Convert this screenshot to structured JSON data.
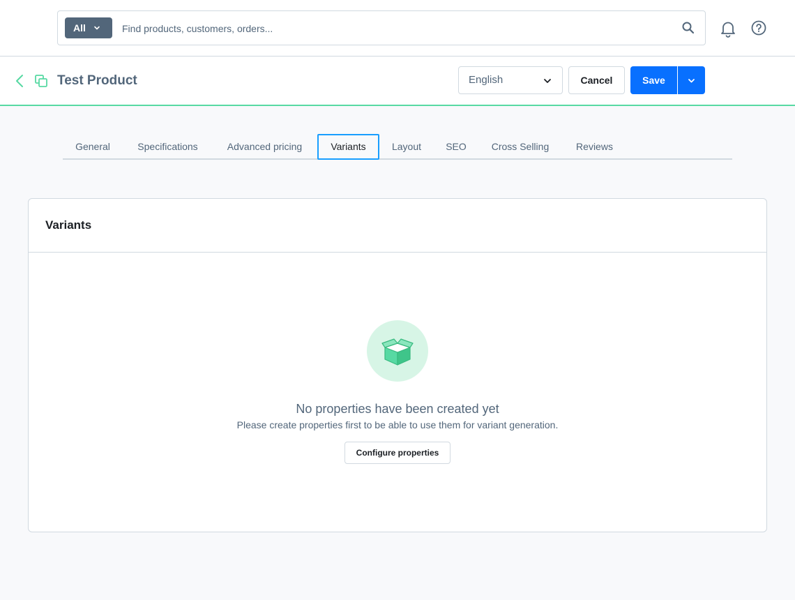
{
  "search": {
    "type_label": "All",
    "placeholder": "Find products, customers, orders..."
  },
  "header": {
    "title": "Test Product",
    "language": "English",
    "cancel_label": "Cancel",
    "save_label": "Save"
  },
  "tabs": [
    {
      "label": "General"
    },
    {
      "label": "Specifications"
    },
    {
      "label": "Advanced pricing"
    },
    {
      "label": "Variants",
      "active": true
    },
    {
      "label": "Layout"
    },
    {
      "label": "SEO"
    },
    {
      "label": "Cross Selling"
    },
    {
      "label": "Reviews"
    }
  ],
  "card": {
    "title": "Variants",
    "empty_title": "No properties have been created yet",
    "empty_subtitle": "Please create properties first to be able to use them for variant generation.",
    "button_label": "Configure properties"
  },
  "colors": {
    "primary": "#0870ff",
    "accent_green": "#57d9a3",
    "active_tab_border": "#189eff",
    "text": "#52667a"
  },
  "icons": [
    "chevron-down-icon",
    "search-icon",
    "bell-icon",
    "help-icon",
    "back-icon",
    "product-copy-icon",
    "open-box-icon"
  ]
}
